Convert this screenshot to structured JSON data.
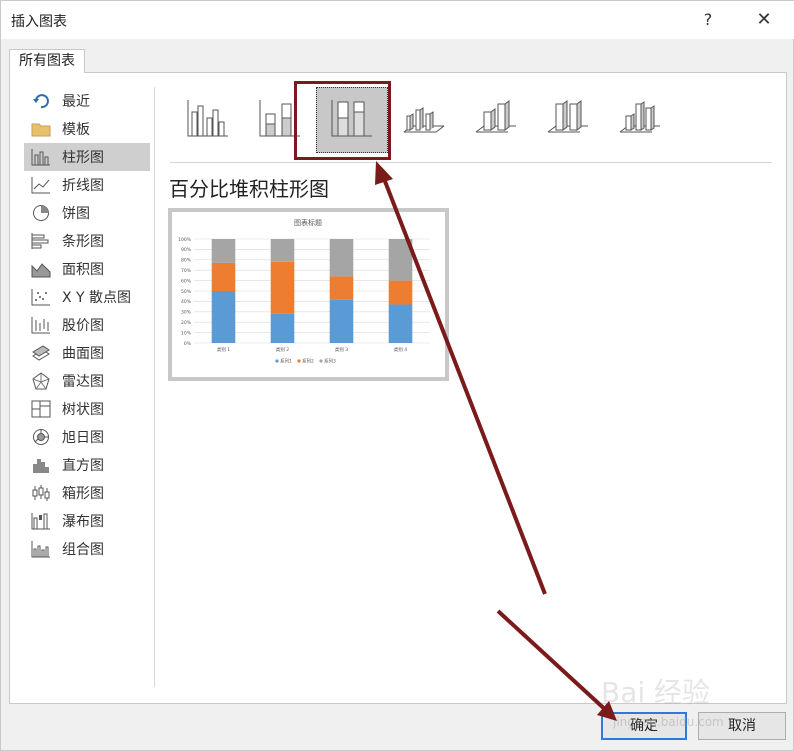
{
  "dialog": {
    "title": "插入图表",
    "help_label": "?",
    "close_label": "✕"
  },
  "tabs": [
    {
      "label": "所有图表"
    }
  ],
  "sidebar": {
    "items": [
      {
        "label": "最近",
        "icon": "recent-icon"
      },
      {
        "label": "模板",
        "icon": "folder-icon"
      },
      {
        "label": "柱形图",
        "icon": "column-chart-icon",
        "selected": true
      },
      {
        "label": "折线图",
        "icon": "line-chart-icon"
      },
      {
        "label": "饼图",
        "icon": "pie-chart-icon"
      },
      {
        "label": "条形图",
        "icon": "bar-chart-icon"
      },
      {
        "label": "面积图",
        "icon": "area-chart-icon"
      },
      {
        "label": "X Y 散点图",
        "icon": "scatter-chart-icon"
      },
      {
        "label": "股价图",
        "icon": "stock-chart-icon"
      },
      {
        "label": "曲面图",
        "icon": "surface-chart-icon"
      },
      {
        "label": "雷达图",
        "icon": "radar-chart-icon"
      },
      {
        "label": "树状图",
        "icon": "treemap-chart-icon"
      },
      {
        "label": "旭日图",
        "icon": "sunburst-chart-icon"
      },
      {
        "label": "直方图",
        "icon": "histogram-chart-icon"
      },
      {
        "label": "箱形图",
        "icon": "box-whisker-chart-icon"
      },
      {
        "label": "瀑布图",
        "icon": "waterfall-chart-icon"
      },
      {
        "label": "组合图",
        "icon": "combo-chart-icon"
      }
    ]
  },
  "subtypes": [
    {
      "icon": "clustered-column-icon"
    },
    {
      "icon": "stacked-column-icon"
    },
    {
      "icon": "percent-stacked-column-icon",
      "selected": true
    },
    {
      "icon": "3d-clustered-column-icon"
    },
    {
      "icon": "3d-stacked-column-icon"
    },
    {
      "icon": "3d-percent-stacked-column-icon"
    },
    {
      "icon": "3d-column-icon"
    }
  ],
  "preview": {
    "title": "百分比堆积柱形图"
  },
  "chart_data": {
    "type": "bar",
    "stacked": "percent",
    "title": "图表标题",
    "categories": [
      "类别 1",
      "类别 2",
      "类别 3",
      "类别 4"
    ],
    "series": [
      {
        "name": "系列1",
        "values": [
          50,
          28,
          42,
          37
        ]
      },
      {
        "name": "系列2",
        "values": [
          27,
          50,
          22,
          23
        ]
      },
      {
        "name": "系列3",
        "values": [
          23,
          22,
          36,
          40
        ]
      }
    ],
    "ylim": [
      0,
      100
    ],
    "yticks": [
      "0%",
      "10%",
      "20%",
      "30%",
      "40%",
      "50%",
      "60%",
      "70%",
      "80%",
      "90%",
      "100%"
    ],
    "grid": true,
    "legend": "bottom"
  },
  "colors": {
    "series1": "#5b9bd5",
    "series2": "#ed7d31",
    "series3": "#a5a5a5",
    "arrow": "#7b1a1a",
    "ok_border": "#2f7ad9"
  },
  "buttons": {
    "ok_label": "确定",
    "cancel_label": "取消"
  },
  "watermark": {
    "text": "Bai 经验",
    "sub": "jingyan.baidu.com"
  }
}
